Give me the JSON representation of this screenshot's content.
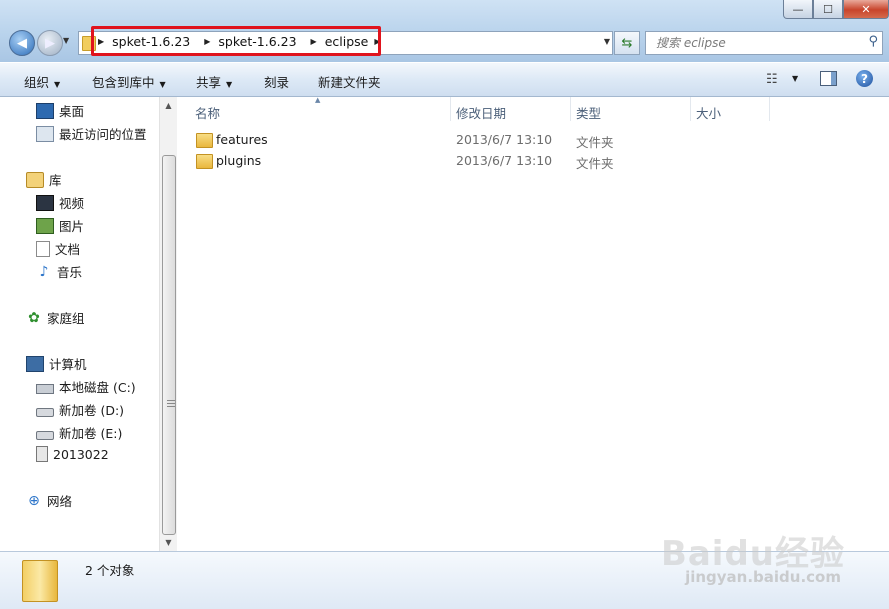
{
  "address": {
    "crumbs": [
      "spket-1.6.23",
      "spket-1.6.23",
      "eclipse"
    ]
  },
  "search": {
    "placeholder": "搜索 eclipse"
  },
  "toolbar": {
    "organize": "组织",
    "include_in_library": "包含到库中",
    "share": "共享",
    "burn": "刻录",
    "new_folder": "新建文件夹"
  },
  "nav": {
    "favorites": [
      "桌面",
      "最近访问的位置"
    ],
    "library_title": "库",
    "libraries": [
      "视频",
      "图片",
      "文档",
      "音乐"
    ],
    "homegroup": "家庭组",
    "computer_title": "计算机",
    "drives": [
      "本地磁盘 (C:)",
      "新加卷 (D:)",
      "新加卷 (E:)",
      "2013022"
    ],
    "network": "网络"
  },
  "columns": {
    "name": "名称",
    "date": "修改日期",
    "type": "类型",
    "size": "大小"
  },
  "files": [
    {
      "name": "features",
      "date": "2013/6/7 13:10",
      "type": "文件夹"
    },
    {
      "name": "plugins",
      "date": "2013/6/7 13:10",
      "type": "文件夹"
    }
  ],
  "status": {
    "count": "2 个对象"
  },
  "watermark": {
    "brand": "Baidu经验",
    "url": "jingyan.baidu.com"
  },
  "colors": {
    "highlight": "#e0131d",
    "accent": "#2c6cb8"
  }
}
